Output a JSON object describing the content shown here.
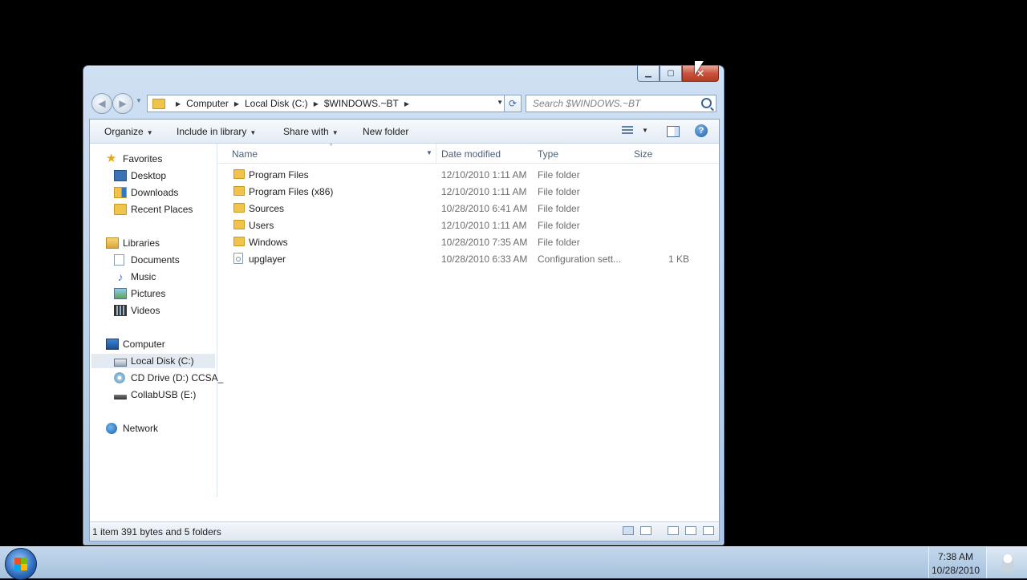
{
  "window": {
    "caption_buttons": {
      "minimize": "▁",
      "maximize": "▢",
      "close": "✕"
    }
  },
  "nav": {
    "back_glyph": "◀",
    "forward_glyph": "▶",
    "recent_glyph": "▼",
    "breadcrumb": [
      "Computer",
      "Local Disk (C:)",
      "$WINDOWS.~BT"
    ],
    "breadcrumb_sep": "▶",
    "address_dropdown": "▼",
    "refresh_glyph": "⟳",
    "search_placeholder": "Search $WINDOWS.~BT"
  },
  "toolbar": {
    "organize": "Organize",
    "include_in_library": "Include in library",
    "share_with": "Share with",
    "new_folder": "New folder",
    "dropdown_arrow": "▼",
    "help": "?"
  },
  "sidebar": {
    "favorites": {
      "label": "Favorites",
      "icon": "star-icon",
      "items": [
        {
          "label": "Desktop",
          "icon": "desktop-icon"
        },
        {
          "label": "Downloads",
          "icon": "downloads-folder-icon"
        },
        {
          "label": "Recent Places",
          "icon": "recent-places-icon"
        }
      ]
    },
    "libraries": {
      "label": "Libraries",
      "icon": "library-icon",
      "items": [
        {
          "label": "Documents",
          "icon": "documents-icon"
        },
        {
          "label": "Music",
          "icon": "music-icon"
        },
        {
          "label": "Pictures",
          "icon": "pictures-icon"
        },
        {
          "label": "Videos",
          "icon": "videos-icon"
        }
      ]
    },
    "computer": {
      "label": "Computer",
      "icon": "computer-icon",
      "items": [
        {
          "label": "Local Disk (C:)",
          "icon": "hard-disk-icon",
          "selected": true
        },
        {
          "label": "CD Drive (D:) CCSA_",
          "icon": "cd-drive-icon"
        },
        {
          "label": "CollabUSB (E:)",
          "icon": "usb-drive-icon"
        }
      ]
    },
    "network": {
      "label": "Network",
      "icon": "network-icon"
    }
  },
  "columns": {
    "name": "Name",
    "date_modified": "Date modified",
    "type": "Type",
    "size": "Size",
    "sort_glyph": "^",
    "dd_glyph": "▼"
  },
  "files": [
    {
      "name": "Program Files",
      "date": "12/10/2010 1:11 AM",
      "type": "File folder",
      "size": "",
      "icon": "folder-icon"
    },
    {
      "name": "Program Files (x86)",
      "date": "12/10/2010 1:11 AM",
      "type": "File folder",
      "size": "",
      "icon": "folder-icon"
    },
    {
      "name": "Sources",
      "date": "10/28/2010 6:41 AM",
      "type": "File folder",
      "size": "",
      "icon": "folder-icon"
    },
    {
      "name": "Users",
      "date": "12/10/2010 1:11 AM",
      "type": "File folder",
      "size": "",
      "icon": "folder-icon"
    },
    {
      "name": "Windows",
      "date": "10/28/2010 7:35 AM",
      "type": "File folder",
      "size": "",
      "icon": "folder-icon"
    },
    {
      "name": "upglayer",
      "date": "10/28/2010 6:33 AM",
      "type": "Configuration sett...",
      "size": "1 KB",
      "icon": "config-file-icon"
    }
  ],
  "status": {
    "text": "1 item 391 bytes and 5 folders"
  },
  "taskbar": {
    "time": "7:38 AM",
    "date": "10/28/2010"
  },
  "colors": {
    "selection": "#e4eaf1",
    "folder": "#f2c34c",
    "close_button": "#c9533e",
    "taskbar": "#b4cce4"
  }
}
